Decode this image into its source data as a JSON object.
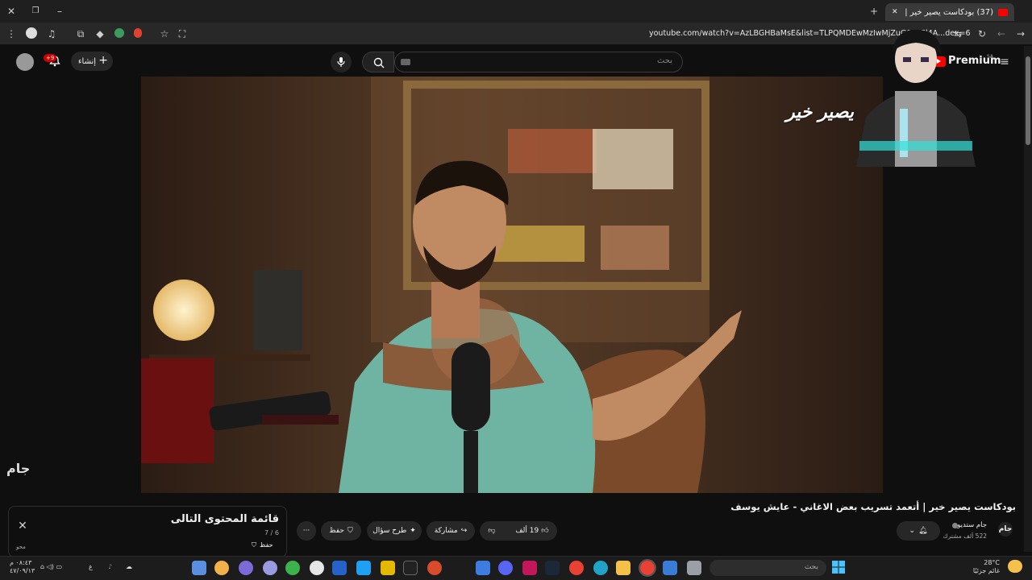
{
  "browser": {
    "tab_title": "(37) بودكاست يصير خير | أتعـ...",
    "new_tab_symbol": "+",
    "tab_close_symbol": "✕",
    "url": "youtube.com/watch?v=AzLBGHBaMsE&list=TLPQMDEwMzIwMjZuG08nPl4A...dex=6"
  },
  "youtube": {
    "logo_text": "Premium",
    "logo_region": "SA",
    "search_placeholder": "بحث",
    "create_label": "إنشاء",
    "notifications_badge": "+9"
  },
  "video": {
    "overlay_logo": "يصير خير",
    "watermark": "جام",
    "title": "بودكاست يصير خير | أتعمد تسريب بعض الاغاني - عايش يوسف"
  },
  "channel": {
    "name": "جام ستديو",
    "subscribers": "522 ألف مشترك"
  },
  "actions": {
    "likes": "19 ألف",
    "share_label": "مشاركة",
    "ask_label": "طرح سؤال",
    "save_label": "حفظ",
    "more_symbol": "···"
  },
  "playlist": {
    "title": "قائمة المحتوى التالى",
    "position": "7 / 6",
    "save_label": "حفظ",
    "sub_label": "محو"
  },
  "taskbar": {
    "search_placeholder": "بحث",
    "weather_temp": "28°C",
    "weather_desc": "غائم جزئيًا",
    "time": "٠٨:٤٣ م",
    "date": "٤٧/٠٩/١٣",
    "lang": "ع"
  }
}
